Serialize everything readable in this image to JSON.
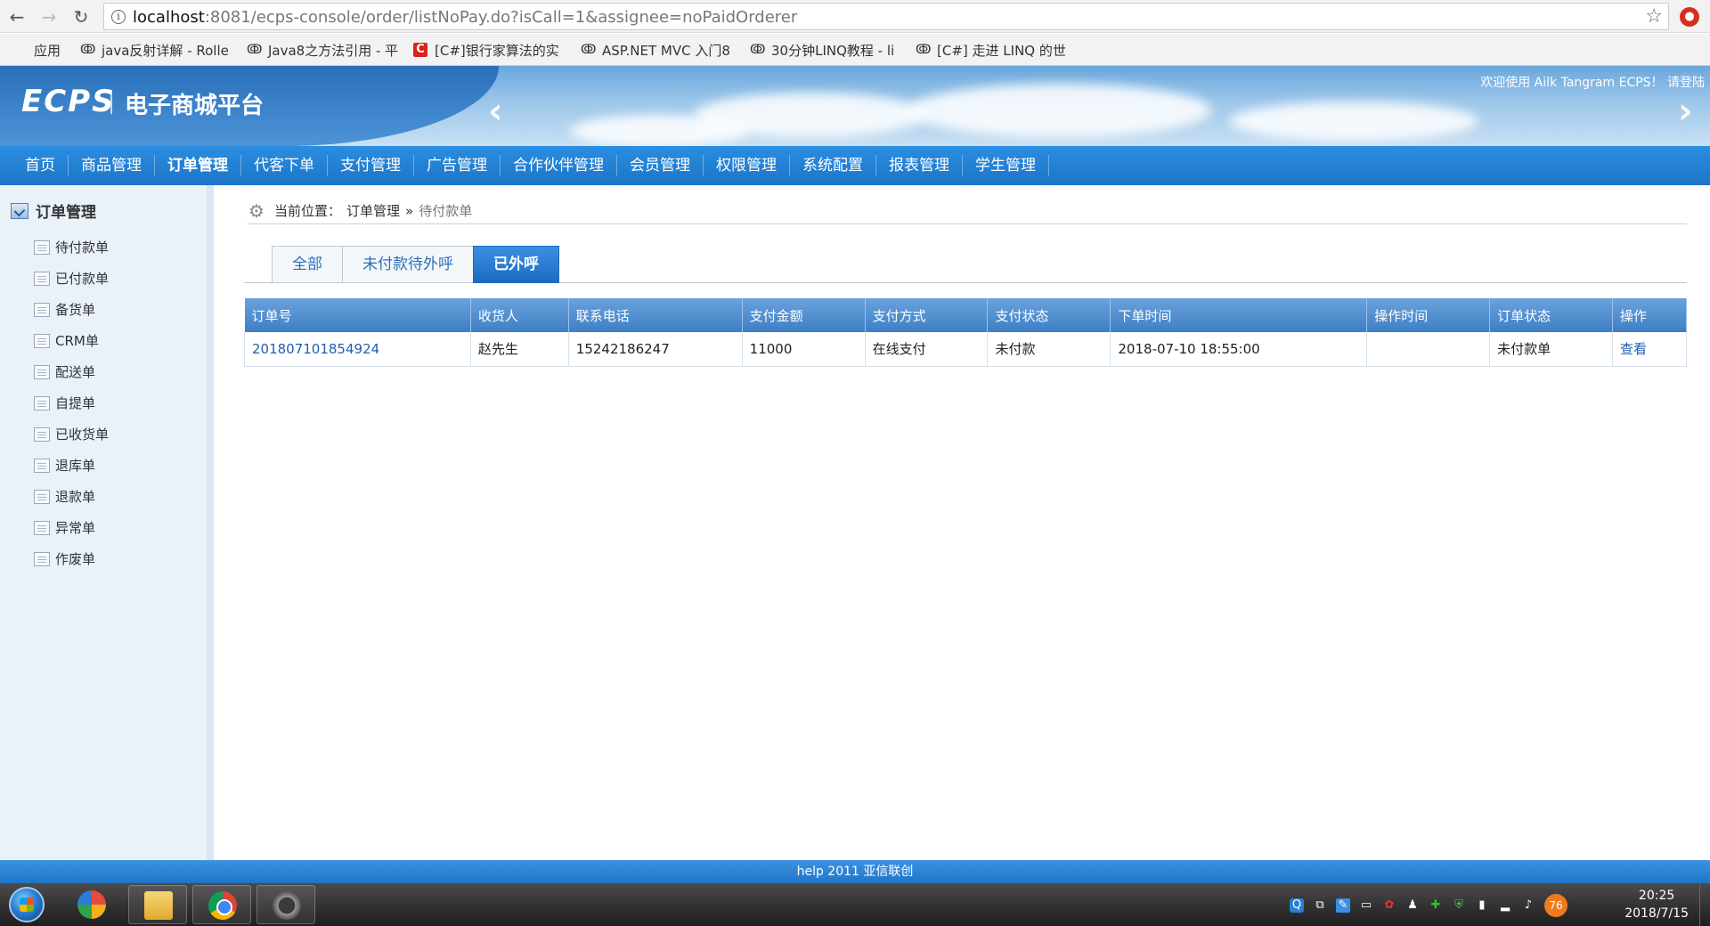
{
  "browser": {
    "url_host": "localhost",
    "url_path": ":8081/ecps-console/order/listNoPay.do?isCall=1&assignee=noPaidOrderer",
    "bookmarks": [
      {
        "label": "应用",
        "icon": "apps-icon"
      },
      {
        "label": "java反射详解 - Rolle",
        "icon": "csdn-icon"
      },
      {
        "label": "Java8之方法引用 - 平",
        "icon": "csdn-icon"
      },
      {
        "label": "[C#]银行家算法的实",
        "icon": "c-icon"
      },
      {
        "label": "ASP.NET MVC 入门8",
        "icon": "csdn-icon"
      },
      {
        "label": "30分钟LINQ教程 - li",
        "icon": "csdn-icon"
      },
      {
        "label": "[C#] 走进 LINQ 的世",
        "icon": "csdn-icon"
      }
    ]
  },
  "header": {
    "logo": "ECPS",
    "subtitle": "电子商城平台",
    "welcome": "欢迎使用 Ailk Tangram ECPS！ 请登陆"
  },
  "nav": {
    "items": [
      "首页",
      "商品管理",
      "订单管理",
      "代客下单",
      "支付管理",
      "广告管理",
      "合作伙伴管理",
      "会员管理",
      "权限管理",
      "系统配置",
      "报表管理",
      "学生管理"
    ],
    "active_index": 2
  },
  "sidebar": {
    "title": "订单管理",
    "items": [
      "待付款单",
      "已付款单",
      "备货单",
      "CRM单",
      "配送单",
      "自提单",
      "已收货单",
      "退库单",
      "退款单",
      "异常单",
      "作废单"
    ]
  },
  "breadcrumb": {
    "prefix": "当前位置：",
    "parent": "订单管理",
    "sep": "»",
    "current": "待付款单"
  },
  "tabs": {
    "items": [
      "全部",
      "未付款待外呼",
      "已外呼"
    ],
    "active_index": 2
  },
  "table": {
    "columns": [
      "订单号",
      "收货人",
      "联系电话",
      "支付金额",
      "支付方式",
      "支付状态",
      "下单时间",
      "操作时间",
      "订单状态",
      "操作"
    ],
    "rows": [
      {
        "order_no": "201807101854924",
        "receiver": "赵先生",
        "phone": "15242186247",
        "amount": "11000",
        "pay_method": "在线支付",
        "pay_status": "未付款",
        "order_time": "2018-07-10 18:55:00",
        "op_time": "",
        "order_status": "未付款单",
        "action": "查看"
      }
    ]
  },
  "footer": {
    "text": "help 2011 亚信联创"
  },
  "taskbar": {
    "tray_badge": "76",
    "time": "20:25",
    "date": "2018/7/15"
  },
  "colors": {
    "nav_blue": "#1d74c8",
    "link_blue": "#1f5fb0",
    "header_blue": "#6aa7dc"
  }
}
